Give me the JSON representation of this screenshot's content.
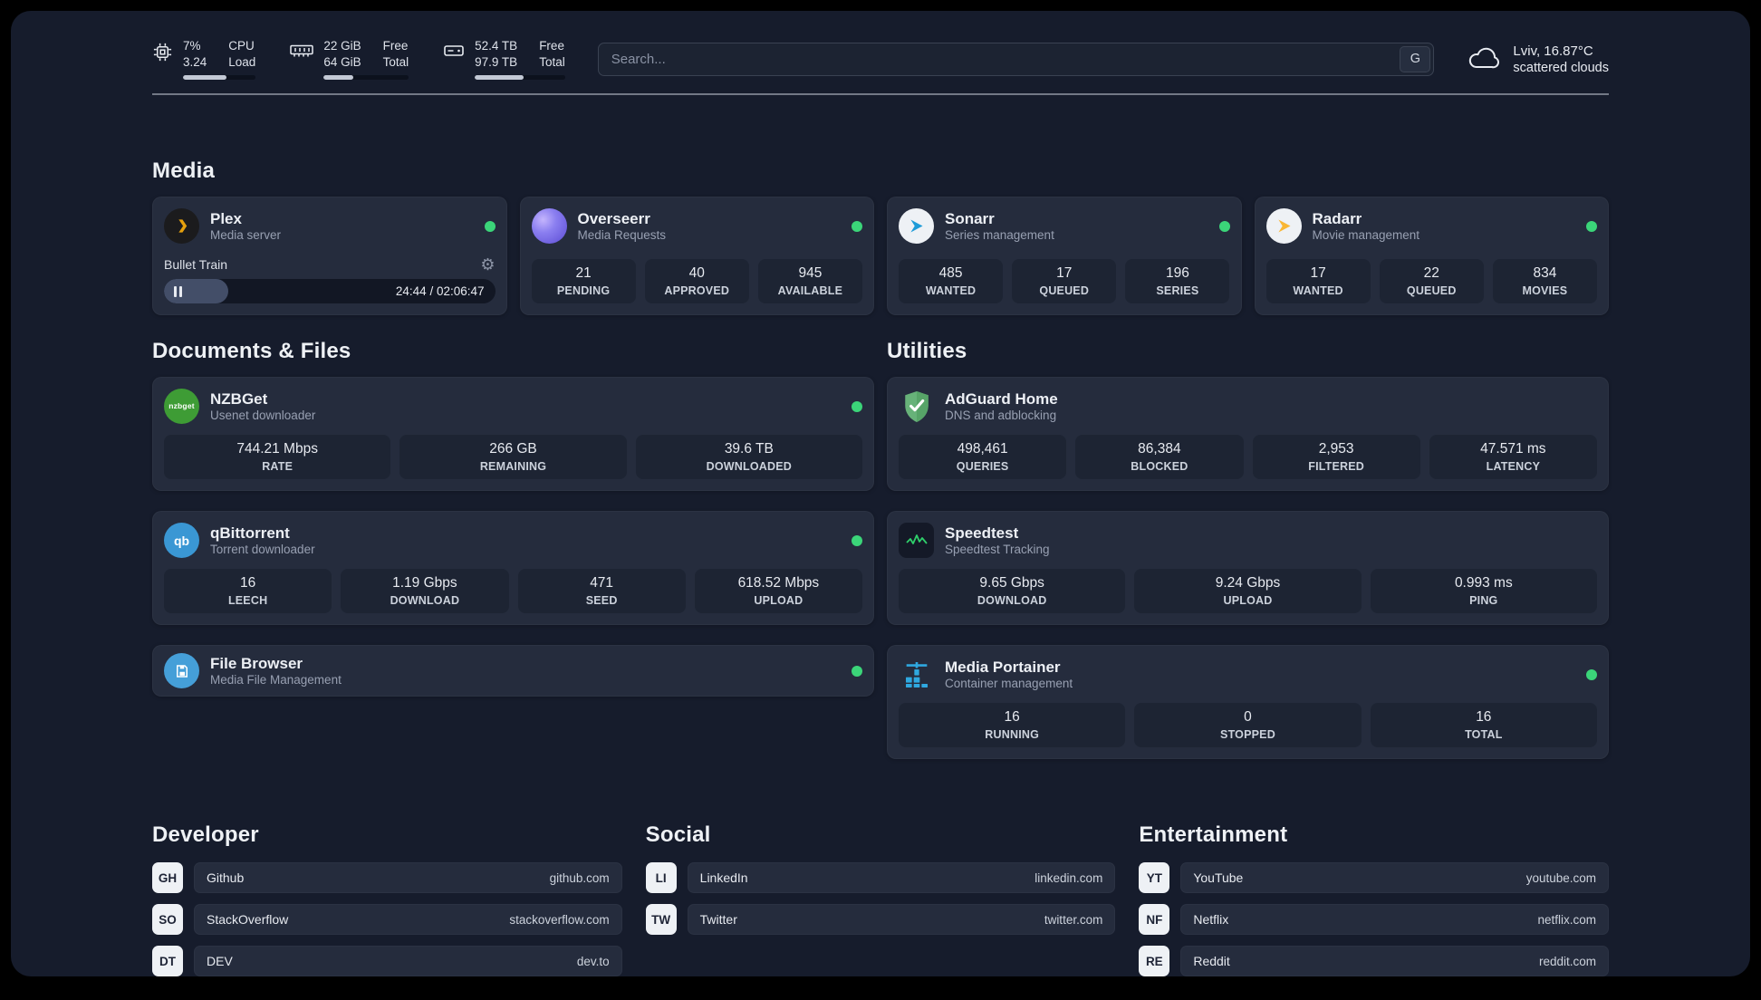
{
  "colors": {
    "status_online": "#3bd579",
    "accent_plex": "#e5a00d",
    "accent_sonarr": "#1d9bd8",
    "accent_radarr": "#f9b634",
    "accent_speedtest_line": "#2fd06b"
  },
  "icons": {
    "cpu": "cpu-chip-icon",
    "ram": "memory-icon",
    "disk": "storage-icon",
    "search_engine": "google-engine-badge",
    "weather": "cloud-icon",
    "plex_settings": "gear-icon",
    "plex_player": "pause-icon",
    "status": "status-dot"
  },
  "topbar": {
    "cpu": {
      "row1_value": "7%",
      "row1_label": "CPU",
      "row2_value": "3.24",
      "row2_label": "Load",
      "progress_pct": 60
    },
    "ram": {
      "row1_value": "22 GiB",
      "row1_label": "Free",
      "row2_value": "64 GiB",
      "row2_label": "Total",
      "progress_pct": 35
    },
    "disk": {
      "row1_value": "52.4 TB",
      "row1_label": "Free",
      "row2_value": "97.9 TB",
      "row2_label": "Total",
      "progress_pct": 54
    },
    "search": {
      "placeholder": "Search...",
      "engine_button": "G"
    },
    "weather": {
      "location": "Lviv, 16.87°C",
      "condition": "scattered clouds"
    }
  },
  "media": {
    "title": "Media",
    "plex": {
      "name": "Plex",
      "subtitle": "Media server",
      "now_playing": {
        "title": "Bullet Train",
        "time": "24:44 / 02:06:47",
        "progress_pct": 19.5
      }
    },
    "overseerr": {
      "name": "Overseerr",
      "subtitle": "Media Requests",
      "stats": [
        {
          "value": "21",
          "label": "PENDING"
        },
        {
          "value": "40",
          "label": "APPROVED"
        },
        {
          "value": "945",
          "label": "AVAILABLE"
        }
      ]
    },
    "sonarr": {
      "name": "Sonarr",
      "subtitle": "Series management",
      "stats": [
        {
          "value": "485",
          "label": "WANTED"
        },
        {
          "value": "17",
          "label": "QUEUED"
        },
        {
          "value": "196",
          "label": "SERIES"
        }
      ]
    },
    "radarr": {
      "name": "Radarr",
      "subtitle": "Movie management",
      "stats": [
        {
          "value": "17",
          "label": "WANTED"
        },
        {
          "value": "22",
          "label": "QUEUED"
        },
        {
          "value": "834",
          "label": "MOVIES"
        }
      ]
    }
  },
  "files": {
    "title": "Documents & Files",
    "nzbget": {
      "name": "NZBGet",
      "subtitle": "Usenet downloader",
      "icon_text": "nzbget",
      "stats": [
        {
          "value": "744.21 Mbps",
          "label": "RATE"
        },
        {
          "value": "266 GB",
          "label": "REMAINING"
        },
        {
          "value": "39.6 TB",
          "label": "DOWNLOADED"
        }
      ]
    },
    "qbittorrent": {
      "name": "qBittorrent",
      "subtitle": "Torrent downloader",
      "icon_text": "qb",
      "stats": [
        {
          "value": "16",
          "label": "LEECH"
        },
        {
          "value": "1.19 Gbps",
          "label": "DOWNLOAD"
        },
        {
          "value": "471",
          "label": "SEED"
        },
        {
          "value": "618.52 Mbps",
          "label": "UPLOAD"
        }
      ]
    },
    "filebrowser": {
      "name": "File Browser",
      "subtitle": "Media File Management"
    }
  },
  "utilities": {
    "title": "Utilities",
    "adguard": {
      "name": "AdGuard Home",
      "subtitle": "DNS and adblocking",
      "stats": [
        {
          "value": "498,461",
          "label": "QUERIES"
        },
        {
          "value": "86,384",
          "label": "BLOCKED"
        },
        {
          "value": "2,953",
          "label": "FILTERED"
        },
        {
          "value": "47.571 ms",
          "label": "LATENCY"
        }
      ]
    },
    "speedtest": {
      "name": "Speedtest",
      "subtitle": "Speedtest Tracking",
      "stats": [
        {
          "value": "9.65 Gbps",
          "label": "DOWNLOAD"
        },
        {
          "value": "9.24 Gbps",
          "label": "UPLOAD"
        },
        {
          "value": "0.993 ms",
          "label": "PING"
        }
      ]
    },
    "portainer": {
      "name": "Media Portainer",
      "subtitle": "Container management",
      "stats": [
        {
          "value": "16",
          "label": "RUNNING"
        },
        {
          "value": "0",
          "label": "STOPPED"
        },
        {
          "value": "16",
          "label": "TOTAL"
        }
      ]
    }
  },
  "bookmarks": {
    "developer": {
      "title": "Developer",
      "items": [
        {
          "abbr": "GH",
          "name": "Github",
          "host": "github.com"
        },
        {
          "abbr": "SO",
          "name": "StackOverflow",
          "host": "stackoverflow.com"
        },
        {
          "abbr": "DT",
          "name": "DEV",
          "host": "dev.to"
        }
      ]
    },
    "social": {
      "title": "Social",
      "items": [
        {
          "abbr": "LI",
          "name": "LinkedIn",
          "host": "linkedin.com"
        },
        {
          "abbr": "TW",
          "name": "Twitter",
          "host": "twitter.com"
        }
      ]
    },
    "entertainment": {
      "title": "Entertainment",
      "items": [
        {
          "abbr": "YT",
          "name": "YouTube",
          "host": "youtube.com"
        },
        {
          "abbr": "NF",
          "name": "Netflix",
          "host": "netflix.com"
        },
        {
          "abbr": "RE",
          "name": "Reddit",
          "host": "reddit.com"
        }
      ]
    }
  }
}
